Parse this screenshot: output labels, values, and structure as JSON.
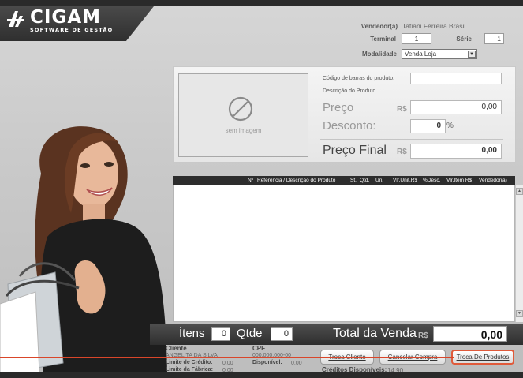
{
  "brand": {
    "name": "CIGAM",
    "tagline": "SOFTWARE DE GESTÃO"
  },
  "header": {
    "vendedor_label": "Vendedor(a)",
    "vendedor_value": "Tatiani Ferreira Brasil",
    "terminal_label": "Terminal",
    "terminal_value": "1",
    "serie_label": "Série",
    "serie_value": "1",
    "modalidade_label": "Modalidade",
    "modalidade_value": "Venda Loja"
  },
  "product": {
    "no_image_text": "sem imagem",
    "barcode_label": "Código de barras do produto:",
    "barcode_value": "",
    "description_label": "Descrição do Produto",
    "price_label": "Preço",
    "price_currency": "R$",
    "price_value": "0,00",
    "discount_label": "Desconto:",
    "discount_value": "0",
    "discount_unit": "%",
    "final_price_label": "Preço Final",
    "final_price_currency": "R$",
    "final_price_value": "0,00"
  },
  "table": {
    "columns": [
      "Nº",
      "Referência / Descrição do Produto",
      "St.",
      "Qtd.",
      "Un.",
      "Vlr.Unit.R$",
      "%Desc.",
      "Vlr.Item R$",
      "Vendedor(a)"
    ],
    "rows": []
  },
  "totals": {
    "items_label": "Ítens",
    "items_value": "0",
    "qty_label": "Qtde",
    "qty_value": "0",
    "total_label": "Total da Venda",
    "total_currency": "R$",
    "total_value": "0,00"
  },
  "footer": {
    "cliente_label": "Cliente",
    "cliente_value": "ANGELITA DA SILVA",
    "cpf_label": "CPF",
    "cpf_value": "000.000.000-00",
    "limite_credito_label": "Limite de Crédito:",
    "limite_credito_value": "0,00",
    "disponivel_label": "Disponível:",
    "disponivel_value": "0,00",
    "limite_fabrica_label": "Limite da Fábrica:",
    "limite_fabrica_value": "0,00",
    "creditos_label": "Créditos Disponíveis:",
    "creditos_value": "14,90"
  },
  "buttons": {
    "troca_cliente": "Troca Cliente",
    "cancelar_compra": "Cancelar Compra",
    "troca_produtos": "Troca De Produtos"
  },
  "colors": {
    "highlight": "#e05a3a",
    "header_dark": "#2a2a2a",
    "panel": "#f0f0f0"
  },
  "icons": {
    "no_image": "no-image-icon",
    "dropdown": "chevron-down-icon",
    "scroll_up": "scroll-up-icon",
    "scroll_down": "scroll-down-icon"
  }
}
